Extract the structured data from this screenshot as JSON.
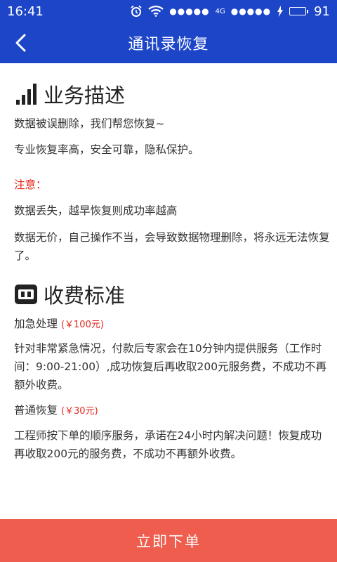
{
  "status_bar": {
    "time": "16:41",
    "signal_dots_1": "●●●●●",
    "network_type": "4G",
    "signal_dots_2": "●●●●●",
    "battery_level": "91",
    "icons": [
      "alarm-icon",
      "wifi-icon",
      "charging-icon",
      "battery-icon"
    ]
  },
  "nav": {
    "title": "通讯录恢复",
    "back_icon": "chevron-left-icon"
  },
  "business": {
    "title": "业务描述",
    "icon": "signal-bars-icon",
    "line1": "数据被误删除，我们帮您恢复~",
    "line2": "专业恢复率高，安全可靠，隐私保护。",
    "notice_label": "注意：",
    "notice1": "数据丢失，越早恢复则成功率越高",
    "notice2": "数据无价，自己操作不当，会导致数据物理删除，将永远无法恢复了。"
  },
  "pricing": {
    "title": "收费标准",
    "icon": "ticket-icon",
    "urgent": {
      "name": "加急处理",
      "price": "(￥100元)",
      "desc": "针对非常紧急情况，付款后专家会在10分钟内提供服务（工作时间：9:00-21:00）,成功恢复后再收取200元服务费，不成功不再额外收费。"
    },
    "normal": {
      "name": "普通恢复",
      "price": "(￥30元)",
      "desc": "工程师按下单的顺序服务，承诺在24小时内解决问题！恢复成功再收取200元的服务费，不成功不再额外收费。"
    }
  },
  "order_button": "立即下单",
  "colors": {
    "primary": "#1c45c8",
    "accent_red": "#e2261c",
    "button": "#ee5d4e"
  }
}
